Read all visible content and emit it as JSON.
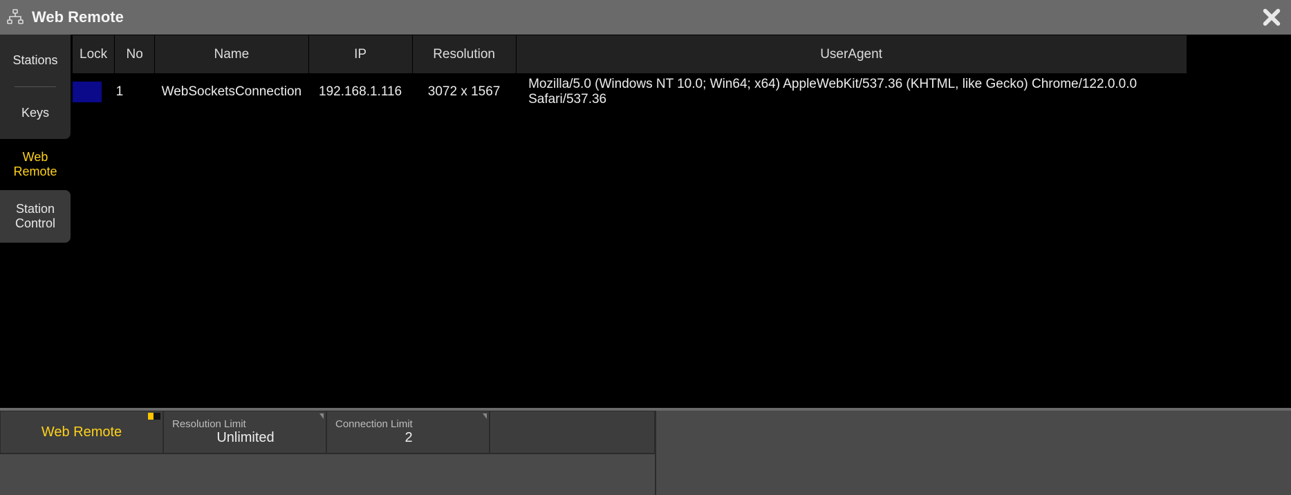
{
  "titlebar": {
    "title": "Web Remote"
  },
  "sidebar": {
    "tabs": [
      {
        "label": "Stations"
      },
      {
        "label": "Keys"
      },
      {
        "label": "Web\nRemote"
      },
      {
        "label": "Station\nControl"
      }
    ]
  },
  "table": {
    "headers": {
      "lock": "Lock",
      "no": "No",
      "name": "Name",
      "ip": "IP",
      "resolution": "Resolution",
      "useragent": "UserAgent"
    },
    "rows": [
      {
        "no": "1",
        "name": "WebSocketsConnection",
        "ip": "192.168.1.116",
        "resolution": "3072 x 1567",
        "useragent": "Mozilla/5.0 (Windows NT 10.0; Win64; x64) AppleWebKit/537.36 (KHTML, like Gecko) Chrome/122.0.0.0 Safari/537.36"
      }
    ]
  },
  "bottom": {
    "section_title": "Web Remote",
    "resolution_limit": {
      "label": "Resolution Limit",
      "value": "Unlimited"
    },
    "connection_limit": {
      "label": "Connection Limit",
      "value": "2"
    }
  }
}
